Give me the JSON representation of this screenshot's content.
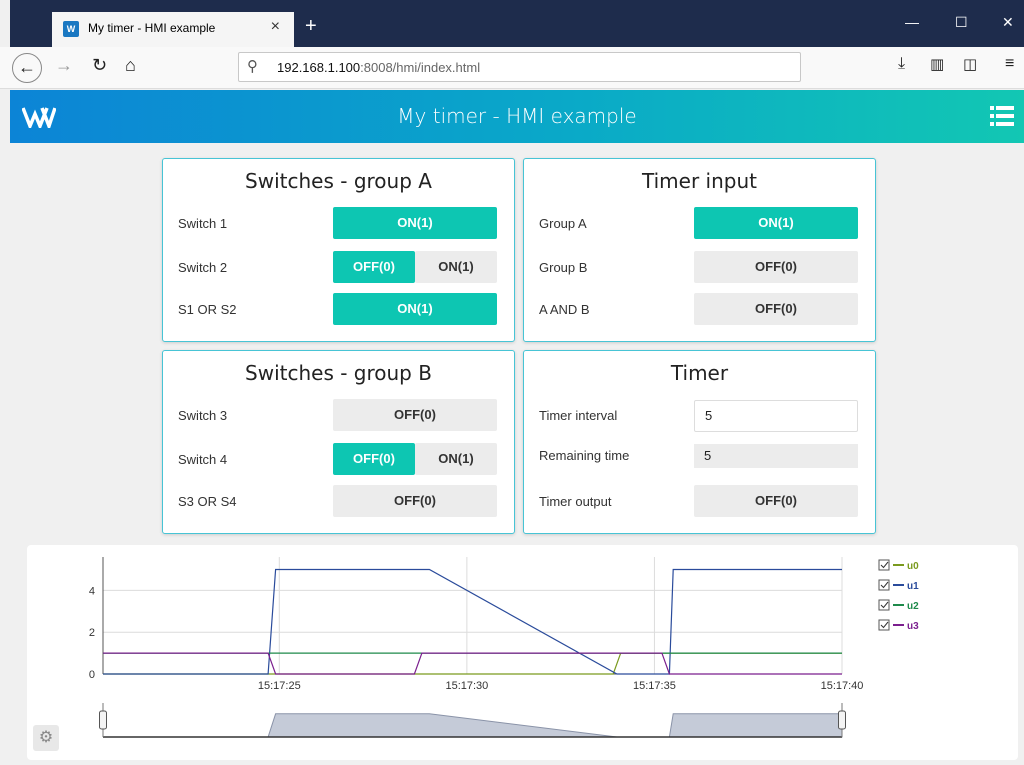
{
  "browser": {
    "tab_title": "My timer - HMI example",
    "favicon_text": "W",
    "tab_close": "×",
    "new_tab": "+",
    "url_host": "192.168.1.100",
    "url_rest": ":8008/hmi/index.html",
    "win_minimize": "—",
    "win_maximize": "☐",
    "win_close": "✕"
  },
  "app": {
    "title": "My timer - HMI example"
  },
  "panels": {
    "group_a": {
      "title": "Switches - group A",
      "rows": [
        {
          "label": "Switch 1",
          "on": "ON(1)"
        },
        {
          "label": "Switch 2",
          "off": "OFF(0)",
          "on": "ON(1)"
        },
        {
          "label": "S1 OR S2",
          "value": "ON(1)"
        }
      ]
    },
    "timer_input": {
      "title": "Timer input",
      "rows": [
        {
          "label": "Group A",
          "value": "ON(1)"
        },
        {
          "label": "Group B",
          "value": "OFF(0)"
        },
        {
          "label": "A AND B",
          "value": "OFF(0)"
        }
      ]
    },
    "group_b": {
      "title": "Switches - group B",
      "rows": [
        {
          "label": "Switch 3",
          "value": "OFF(0)"
        },
        {
          "label": "Switch 4",
          "off": "OFF(0)",
          "on": "ON(1)"
        },
        {
          "label": "S3 OR S4",
          "value": "OFF(0)"
        }
      ]
    },
    "timer": {
      "title": "Timer",
      "rows": [
        {
          "label": "Timer interval",
          "value": "5"
        },
        {
          "label": "Remaining time",
          "value": "5"
        },
        {
          "label": "Timer output",
          "value": "OFF(0)"
        }
      ]
    }
  },
  "colors": {
    "accent_on": "#0dc6b2",
    "off_bg": "#ececec",
    "u0": "#7a9a1e",
    "u1": "#2a4b9b",
    "u2": "#1e8a4a",
    "u3": "#7b1f8e"
  },
  "chart_data": {
    "type": "line",
    "xlabel": "",
    "ylabel": "",
    "x_ticks": [
      "15:17:25",
      "15:17:30",
      "15:17:35",
      "15:17:40"
    ],
    "x_tick_seconds": [
      25,
      30,
      35,
      40
    ],
    "x_range_seconds": [
      20.3,
      40
    ],
    "y_ticks": [
      0,
      2,
      4
    ],
    "ylim": [
      0,
      5.6
    ],
    "grid": true,
    "legend_position": "right",
    "series": [
      {
        "name": "u0",
        "color": "#7a9a1e",
        "points": [
          [
            20.3,
            0
          ],
          [
            33.9,
            0
          ],
          [
            34.1,
            1
          ],
          [
            40,
            1
          ]
        ]
      },
      {
        "name": "u1",
        "color": "#2a4b9b",
        "points": [
          [
            20.3,
            0
          ],
          [
            24.7,
            0
          ],
          [
            24.9,
            5
          ],
          [
            29,
            5
          ],
          [
            34,
            0
          ],
          [
            35.4,
            0
          ],
          [
            35.5,
            5
          ],
          [
            40,
            5
          ]
        ]
      },
      {
        "name": "u2",
        "color": "#1e8a4a",
        "points": [
          [
            20.3,
            1
          ],
          [
            40,
            1
          ]
        ]
      },
      {
        "name": "u3",
        "color": "#7b1f8e",
        "points": [
          [
            20.3,
            1
          ],
          [
            24.7,
            1
          ],
          [
            24.9,
            0
          ],
          [
            28.6,
            0
          ],
          [
            28.8,
            1
          ],
          [
            35.2,
            1
          ],
          [
            35.4,
            0
          ],
          [
            40,
            0
          ]
        ]
      }
    ],
    "legend": [
      "u0",
      "u1",
      "u2",
      "u3"
    ]
  }
}
